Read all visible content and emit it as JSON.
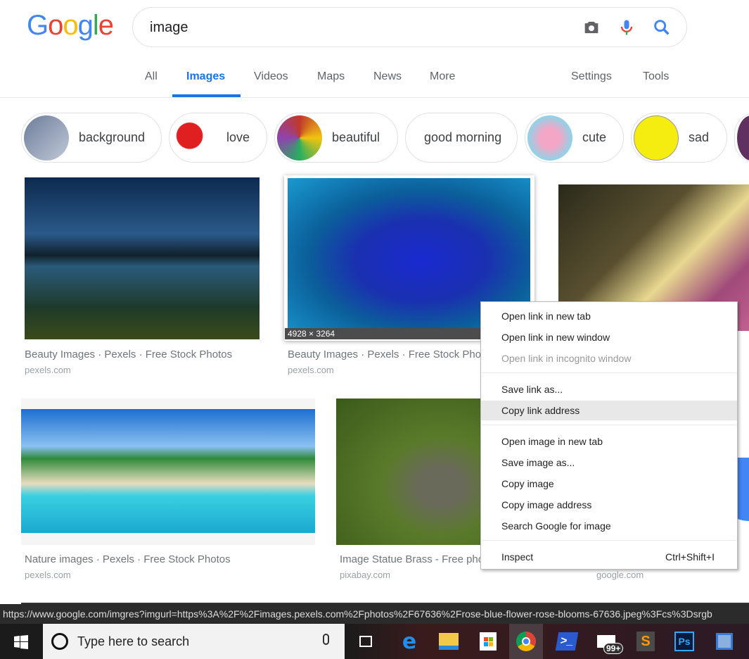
{
  "logo": "Google",
  "search": {
    "query": "image"
  },
  "tabs": [
    {
      "label": "All"
    },
    {
      "label": "Images",
      "active": true
    },
    {
      "label": "Videos"
    },
    {
      "label": "Maps"
    },
    {
      "label": "News"
    },
    {
      "label": "More"
    }
  ],
  "tools": {
    "settings": "Settings",
    "tools": "Tools"
  },
  "chips": [
    {
      "label": "background"
    },
    {
      "label": "love"
    },
    {
      "label": "beautiful"
    },
    {
      "label": "good morning"
    },
    {
      "label": "cute"
    },
    {
      "label": "sad"
    }
  ],
  "results": [
    {
      "caption": "Beauty Images · Pexels · Free Stock Photos",
      "source": "pexels.com"
    },
    {
      "caption": "Beauty Images · Pexels · Free Stock Photos",
      "source": "pexels.com",
      "dimensions": "4928 × 3264"
    },
    {
      "caption": "Nature images · Pexels · Free Stock Photos",
      "source": "pexels.com"
    },
    {
      "caption": "Image Statue Brass - Free photo",
      "source": "pixabay.com"
    },
    {
      "caption": "",
      "source": "google.com"
    }
  ],
  "context_menu": {
    "items": [
      {
        "label": "Open link in new tab"
      },
      {
        "label": "Open link in new window"
      },
      {
        "label": "Open link in incognito window",
        "disabled": true
      },
      {
        "label": "Save link as..."
      },
      {
        "label": "Copy link address",
        "highlighted": true
      },
      {
        "label": "Open image in new tab"
      },
      {
        "label": "Save image as..."
      },
      {
        "label": "Copy image"
      },
      {
        "label": "Copy image address"
      },
      {
        "label": "Search Google for image"
      },
      {
        "label": "Inspect",
        "shortcut": "Ctrl+Shift+I"
      }
    ]
  },
  "status_url": "https://www.google.com/imgres?imgurl=https%3A%2F%2Fimages.pexels.com%2Fphotos%2F67636%2Frose-blue-flower-rose-blooms-67636.jpeg%3Fcs%3Dsrgb",
  "taskbar": {
    "search_placeholder": "Type here to search",
    "mail_badge": "99+",
    "ps_label": "Ps"
  },
  "colors": {
    "accent": "#1a73e8"
  }
}
